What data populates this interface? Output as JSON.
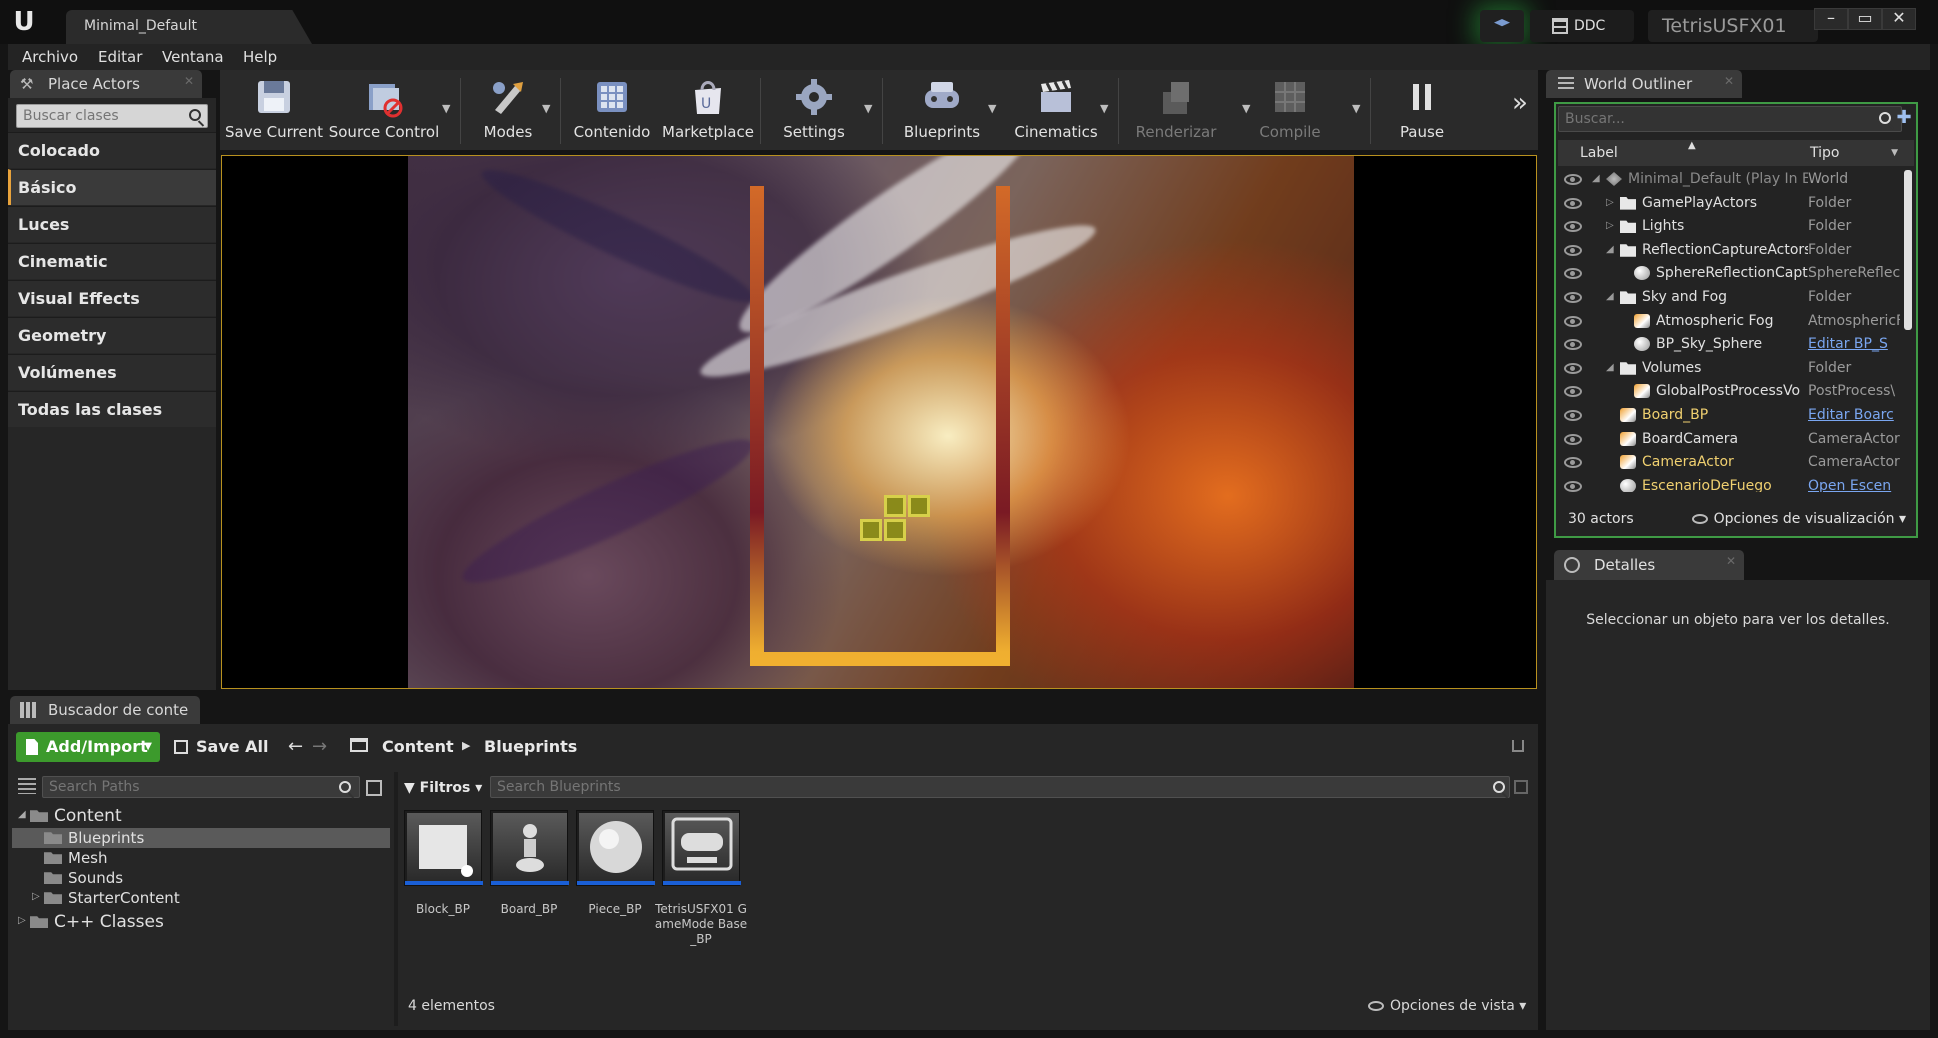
{
  "window": {
    "doc_tab": "Minimal_Default",
    "project_name": "TetrisUSFX01",
    "ddc_label": "DDC",
    "minimize": "–",
    "maximize": "▭",
    "close": "✕"
  },
  "menubar": [
    "Archivo",
    "Editar",
    "Ventana",
    "Help"
  ],
  "place_actors": {
    "tab_label": "Place Actors",
    "search_placeholder": "Buscar clases",
    "categories": [
      "Colocado recientemente",
      "Básico",
      "Luces",
      "Cinematic",
      "Visual Effects",
      "Geometry",
      "Volúmenes",
      "Todas las clases"
    ],
    "active_category": "Básico"
  },
  "toolbar": {
    "buttons": [
      "Save Current",
      "Source Control",
      "Modes",
      "Contenido",
      "Marketplace",
      "Settings",
      "Blueprints",
      "Cinematics",
      "Renderizar",
      "Compile",
      "Pause"
    ],
    "disabled": [
      "Renderizar",
      "Compile"
    ]
  },
  "world_outliner": {
    "tab_label": "World Outliner",
    "search_placeholder": "Buscar...",
    "col_label": "Label",
    "col_type": "Tipo",
    "rows": [
      {
        "label": "Minimal_Default (Play In E",
        "type": "World",
        "indent": 0,
        "icon": "world",
        "expander": "◢",
        "color": "#8a8a8a",
        "link": false
      },
      {
        "label": "GamePlayActors",
        "type": "Folder",
        "indent": 1,
        "icon": "folder",
        "expander": "▷",
        "color": "#e0e0e0",
        "link": false
      },
      {
        "label": "Lights",
        "type": "Folder",
        "indent": 1,
        "icon": "folder",
        "expander": "▷",
        "color": "#e0e0e0",
        "link": false
      },
      {
        "label": "ReflectionCaptureActors",
        "type": "Folder",
        "indent": 1,
        "icon": "folder",
        "expander": "◢",
        "color": "#e0e0e0",
        "link": false
      },
      {
        "label": "SphereReflectionCapt",
        "type": "SphereReflec",
        "indent": 2,
        "icon": "sphere",
        "expander": "",
        "color": "#e0e0e0",
        "link": false
      },
      {
        "label": "Sky and Fog",
        "type": "Folder",
        "indent": 1,
        "icon": "folder",
        "expander": "◢",
        "color": "#e0e0e0",
        "link": false
      },
      {
        "label": "Atmospheric Fog",
        "type": "AtmosphericF",
        "indent": 2,
        "icon": "actor",
        "expander": "",
        "color": "#e0e0e0",
        "link": false
      },
      {
        "label": "BP_Sky_Sphere",
        "type": "Editar BP_S",
        "indent": 2,
        "icon": "sphere",
        "expander": "",
        "color": "#e0e0e0",
        "link": true
      },
      {
        "label": "Volumes",
        "type": "Folder",
        "indent": 1,
        "icon": "folder",
        "expander": "◢",
        "color": "#e0e0e0",
        "link": false
      },
      {
        "label": "GlobalPostProcessVo",
        "type": "PostProcess\\",
        "indent": 2,
        "icon": "actor",
        "expander": "",
        "color": "#e0e0e0",
        "link": false
      },
      {
        "label": "Board_BP",
        "type": "Editar Boarc",
        "indent": 1,
        "icon": "actor",
        "expander": "",
        "color": "#f0d070",
        "link": true
      },
      {
        "label": "BoardCamera",
        "type": "CameraActor",
        "indent": 1,
        "icon": "actor",
        "expander": "",
        "color": "#e0e0e0",
        "link": false
      },
      {
        "label": "CameraActor",
        "type": "CameraActor",
        "indent": 1,
        "icon": "actor",
        "expander": "",
        "color": "#f0d070",
        "link": false
      },
      {
        "label": "EscenarioDeFuego",
        "type": "Open Escen",
        "indent": 1,
        "icon": "sphere",
        "expander": "",
        "color": "#f0d070",
        "link": true
      }
    ],
    "actor_count": "30 actors",
    "view_options": "Opciones de visualización"
  },
  "details": {
    "tab_label": "Detalles",
    "message": "Seleccionar un objeto para ver los detalles."
  },
  "content_browser": {
    "tab_label": "Buscador de conte",
    "add_import": "Add/Import",
    "save_all": "Save All",
    "crumb_root": "Content",
    "crumb_current": "Blueprints",
    "path_search_placeholder": "Search Paths",
    "filters": "Filtros",
    "asset_search_placeholder": "Search Blueprints",
    "tree": [
      {
        "label": "Content",
        "level": 0,
        "expander": "◢",
        "selected": false,
        "big": true
      },
      {
        "label": "Blueprints",
        "level": 1,
        "expander": "",
        "selected": true,
        "big": false
      },
      {
        "label": "Mesh",
        "level": 1,
        "expander": "",
        "selected": false,
        "big": false
      },
      {
        "label": "Sounds",
        "level": 1,
        "expander": "",
        "selected": false,
        "big": false
      },
      {
        "label": "StarterContent",
        "level": 1,
        "expander": "▷",
        "selected": false,
        "big": false
      },
      {
        "label": "C++ Classes",
        "level": 0,
        "expander": "▷",
        "selected": false,
        "big": true
      }
    ],
    "assets": [
      {
        "name": "Block_BP",
        "icon": "cube-icon"
      },
      {
        "name": "Board_BP",
        "icon": "pawn-icon"
      },
      {
        "name": "Piece_BP",
        "icon": "sphere-icon"
      },
      {
        "name": "TetrisUSFX01 GameMode Base_BP",
        "icon": "gamepad-icon"
      }
    ],
    "item_count": "4 elementos",
    "view_options": "Opciones de vista"
  }
}
